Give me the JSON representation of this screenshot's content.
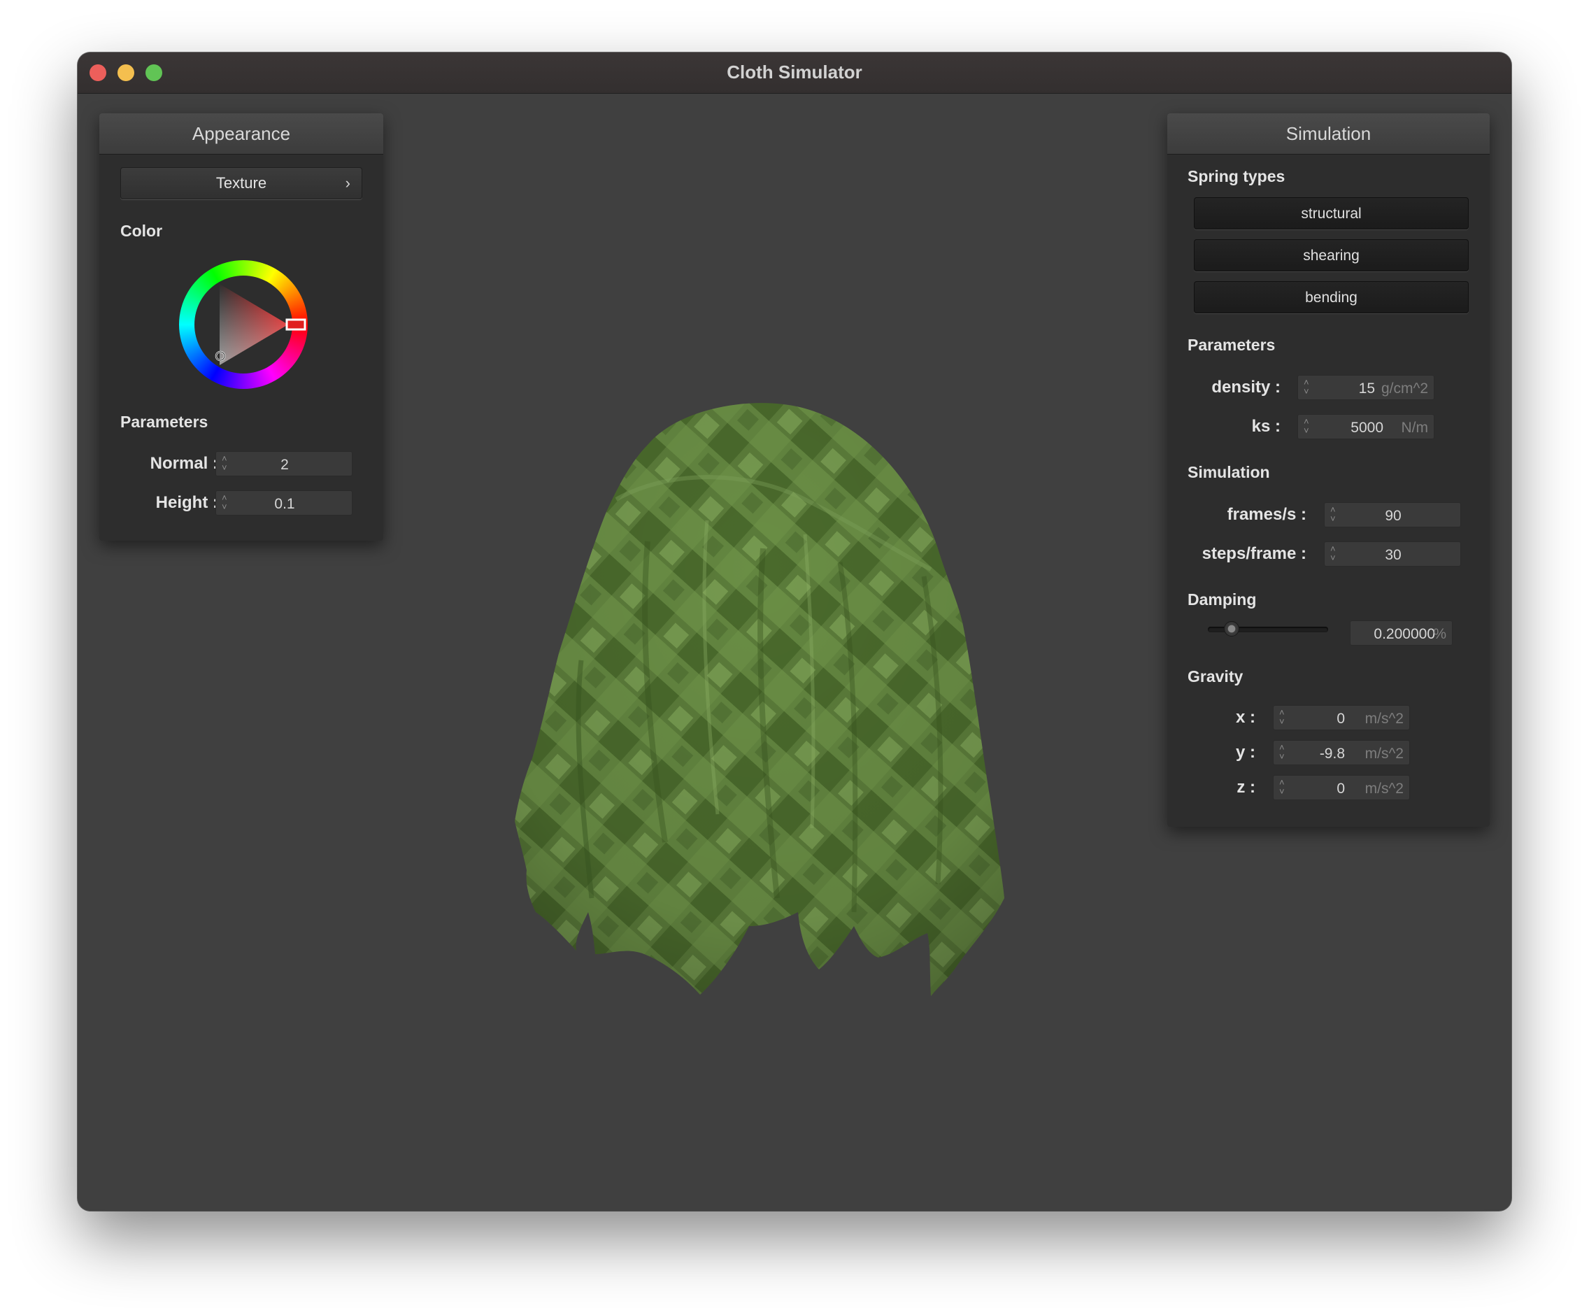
{
  "window": {
    "title": "Cloth Simulator"
  },
  "appearance": {
    "title": "Appearance",
    "texture_button": "Texture",
    "texture_chevron": "›",
    "color_label": "Color",
    "params_label": "Parameters",
    "normal": {
      "label": "Normal :",
      "value": "2"
    },
    "height": {
      "label": "Height :",
      "value": "0.1"
    }
  },
  "simulation_panel": {
    "title": "Simulation",
    "spring_types_label": "Spring types",
    "spring_types": [
      "structural",
      "shearing",
      "bending"
    ],
    "params_label": "Parameters",
    "density": {
      "label": "density :",
      "value": "15",
      "unit": "g/cm^2"
    },
    "ks": {
      "label": "ks :",
      "value": "5000",
      "unit": "N/m"
    },
    "sim_label": "Simulation",
    "fps": {
      "label": "frames/s :",
      "value": "90"
    },
    "steps": {
      "label": "steps/frame :",
      "value": "30"
    },
    "damping_label": "Damping",
    "damping": {
      "value": "0.200000",
      "unit": "%",
      "slider_fraction": 0.2
    },
    "gravity_label": "Gravity",
    "gravity": [
      {
        "label": "x :",
        "value": "0",
        "unit": "m/s^2"
      },
      {
        "label": "y :",
        "value": "-9.8",
        "unit": "m/s^2"
      },
      {
        "label": "z :",
        "value": "0",
        "unit": "m/s^2"
      }
    ]
  },
  "colors": {
    "window_bg": "#404040",
    "panel_bg": "#2d2d2d",
    "cloth_base": "#5c7f3a",
    "picker_hue": "#e02020"
  },
  "icons": {
    "spinner": "spinner-arrows-icon",
    "chevron": "chevron-right-icon",
    "traffic_lights": [
      "close-icon",
      "minimize-icon",
      "maximize-icon"
    ]
  }
}
